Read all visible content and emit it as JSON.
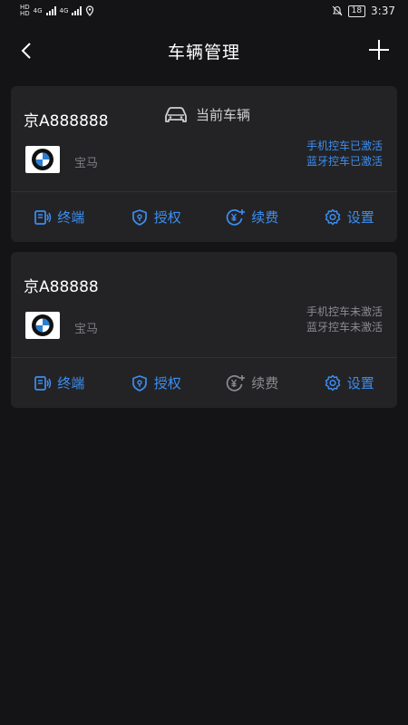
{
  "status_bar": {
    "sim_labels": [
      "HD",
      "HD"
    ],
    "network": "4G",
    "network2": "4G",
    "battery": "18",
    "time": "3:37"
  },
  "header": {
    "title": "车辆管理",
    "back_icon": "chevron-left-icon",
    "add_icon": "plus-icon"
  },
  "vehicles": [
    {
      "plate": "京A888888",
      "current_label": "当前车辆",
      "brand": "宝马",
      "phone_status": "手机控车已激活",
      "bt_status": "蓝牙控车已激活",
      "actions": {
        "terminal": "终端",
        "auth": "授权",
        "renew": "续费",
        "settings": "设置"
      }
    },
    {
      "plate": "京A88888",
      "brand": "宝马",
      "phone_status": "手机控车未激活",
      "bt_status": "蓝牙控车未激活",
      "actions": {
        "terminal": "终端",
        "auth": "授权",
        "renew": "续费",
        "settings": "设置"
      }
    }
  ],
  "colors": {
    "accent": "#3d8ef0",
    "muted": "#8b8b90",
    "card": "#232326",
    "background": "#141416"
  }
}
